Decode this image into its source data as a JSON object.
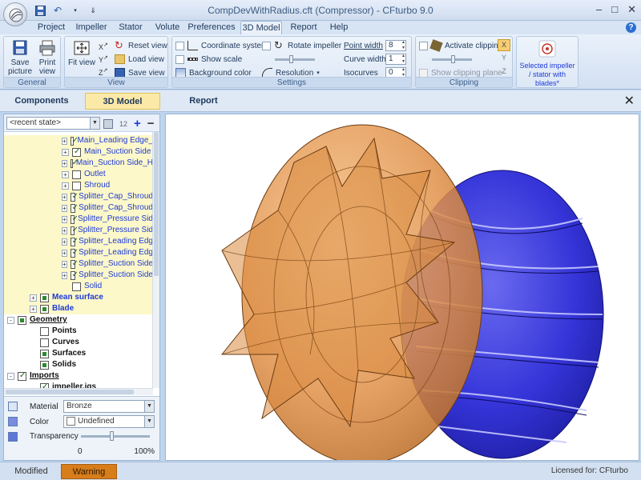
{
  "window": {
    "title": "CompDevWithRadius.cft (Compressor) - CFturbo 9.0",
    "minimize": "–",
    "maximize": "□",
    "close": "✕"
  },
  "tabs": [
    "Project",
    "Impeller",
    "Stator",
    "Volute",
    "Preferences",
    "3D Model",
    "Report",
    "Help"
  ],
  "active_tab": "3D Model",
  "ribbon": {
    "general": {
      "label": "General",
      "save_picture": "Save picture",
      "print_view": "Print view"
    },
    "view": {
      "label": "View",
      "fit_view": "Fit view",
      "reset_view": "Reset view",
      "load_view": "Load view",
      "save_view": "Save view"
    },
    "settings": {
      "label": "Settings",
      "coordinate_system": "Coordinate system",
      "show_scale": "Show scale",
      "background_color": "Background color",
      "rotate_impeller": "Rotate impeller",
      "resolution": "Resolution",
      "point_width_label": "Point width",
      "point_width_value": "8",
      "curve_width_label": "Curve width",
      "curve_width_value": "1",
      "isocurves_label": "Isocurves",
      "isocurves_value": "0"
    },
    "clipping": {
      "label": "Clipping",
      "activate_clipping": "Activate clipping",
      "show_clipping_plane": "Show clipping plane"
    },
    "selection": {
      "label": "Selected impeller / stator with blades*"
    }
  },
  "viewbar": {
    "components": "Components",
    "model3d": "3D Model",
    "report": "Report"
  },
  "state": {
    "placeholder": "<recent state>",
    "counter": "12"
  },
  "tree": [
    {
      "label": "Main_Leading Edge_",
      "checked": true,
      "style": "blue"
    },
    {
      "label": "Main_Suction Side",
      "checked": true,
      "style": "blue"
    },
    {
      "label": "Main_Suction Side_H",
      "checked": true,
      "style": "blue"
    },
    {
      "label": "Outlet",
      "checked": false,
      "style": "blue"
    },
    {
      "label": "Shroud",
      "checked": false,
      "style": "blue"
    },
    {
      "label": "Splitter_Cap_Shroud",
      "checked": true,
      "style": "blue"
    },
    {
      "label": "Splitter_Cap_Shroud",
      "checked": true,
      "style": "blue"
    },
    {
      "label": "Splitter_Pressure Sid",
      "checked": true,
      "style": "blue"
    },
    {
      "label": "Splitter_Pressure Sid",
      "checked": true,
      "style": "blue"
    },
    {
      "label": "Splitter_Leading Edg",
      "checked": true,
      "style": "blue"
    },
    {
      "label": "Splitter_Leading Edg",
      "checked": true,
      "style": "blue"
    },
    {
      "label": "Splitter_Suction Side",
      "checked": true,
      "style": "blue"
    },
    {
      "label": "Splitter_Suction Side",
      "checked": true,
      "style": "blue"
    },
    {
      "label": "Solid",
      "checked": false,
      "style": "blue"
    },
    {
      "label": "Mean surface",
      "checked": false,
      "style": "bluebold"
    },
    {
      "label": "Blade",
      "checked": false,
      "style": "bluebold"
    },
    {
      "label": "Geometry",
      "checked": false,
      "style": "darkbold"
    },
    {
      "label": "Points",
      "checked": false,
      "style": "darkbold"
    },
    {
      "label": "Curves",
      "checked": false,
      "style": "darkbold"
    },
    {
      "label": "Surfaces",
      "checked": false,
      "style": "darkbold"
    },
    {
      "label": "Solids",
      "checked": false,
      "style": "darkbold"
    },
    {
      "label": "Imports",
      "checked": true,
      "style": "darkbold"
    },
    {
      "label": "impeller.igs",
      "checked": true,
      "style": "darkbold"
    }
  ],
  "properties": {
    "material_label": "Material",
    "material_value": "Bronze",
    "color_label": "Color",
    "color_value": "Undefined",
    "transparency_label": "Transparency",
    "transparency_min": "0",
    "transparency_max": "100%",
    "transparency_level": 0.45
  },
  "status": {
    "modified": "Modified",
    "warning": "Warning",
    "licensed": "Licensed for: CFturbo"
  },
  "colors": {
    "impeller_blue": "#3131d6",
    "impeller_bronze": "#e39a4e",
    "warning": "#d77d1a",
    "active_tab": "#fbe9a8"
  }
}
